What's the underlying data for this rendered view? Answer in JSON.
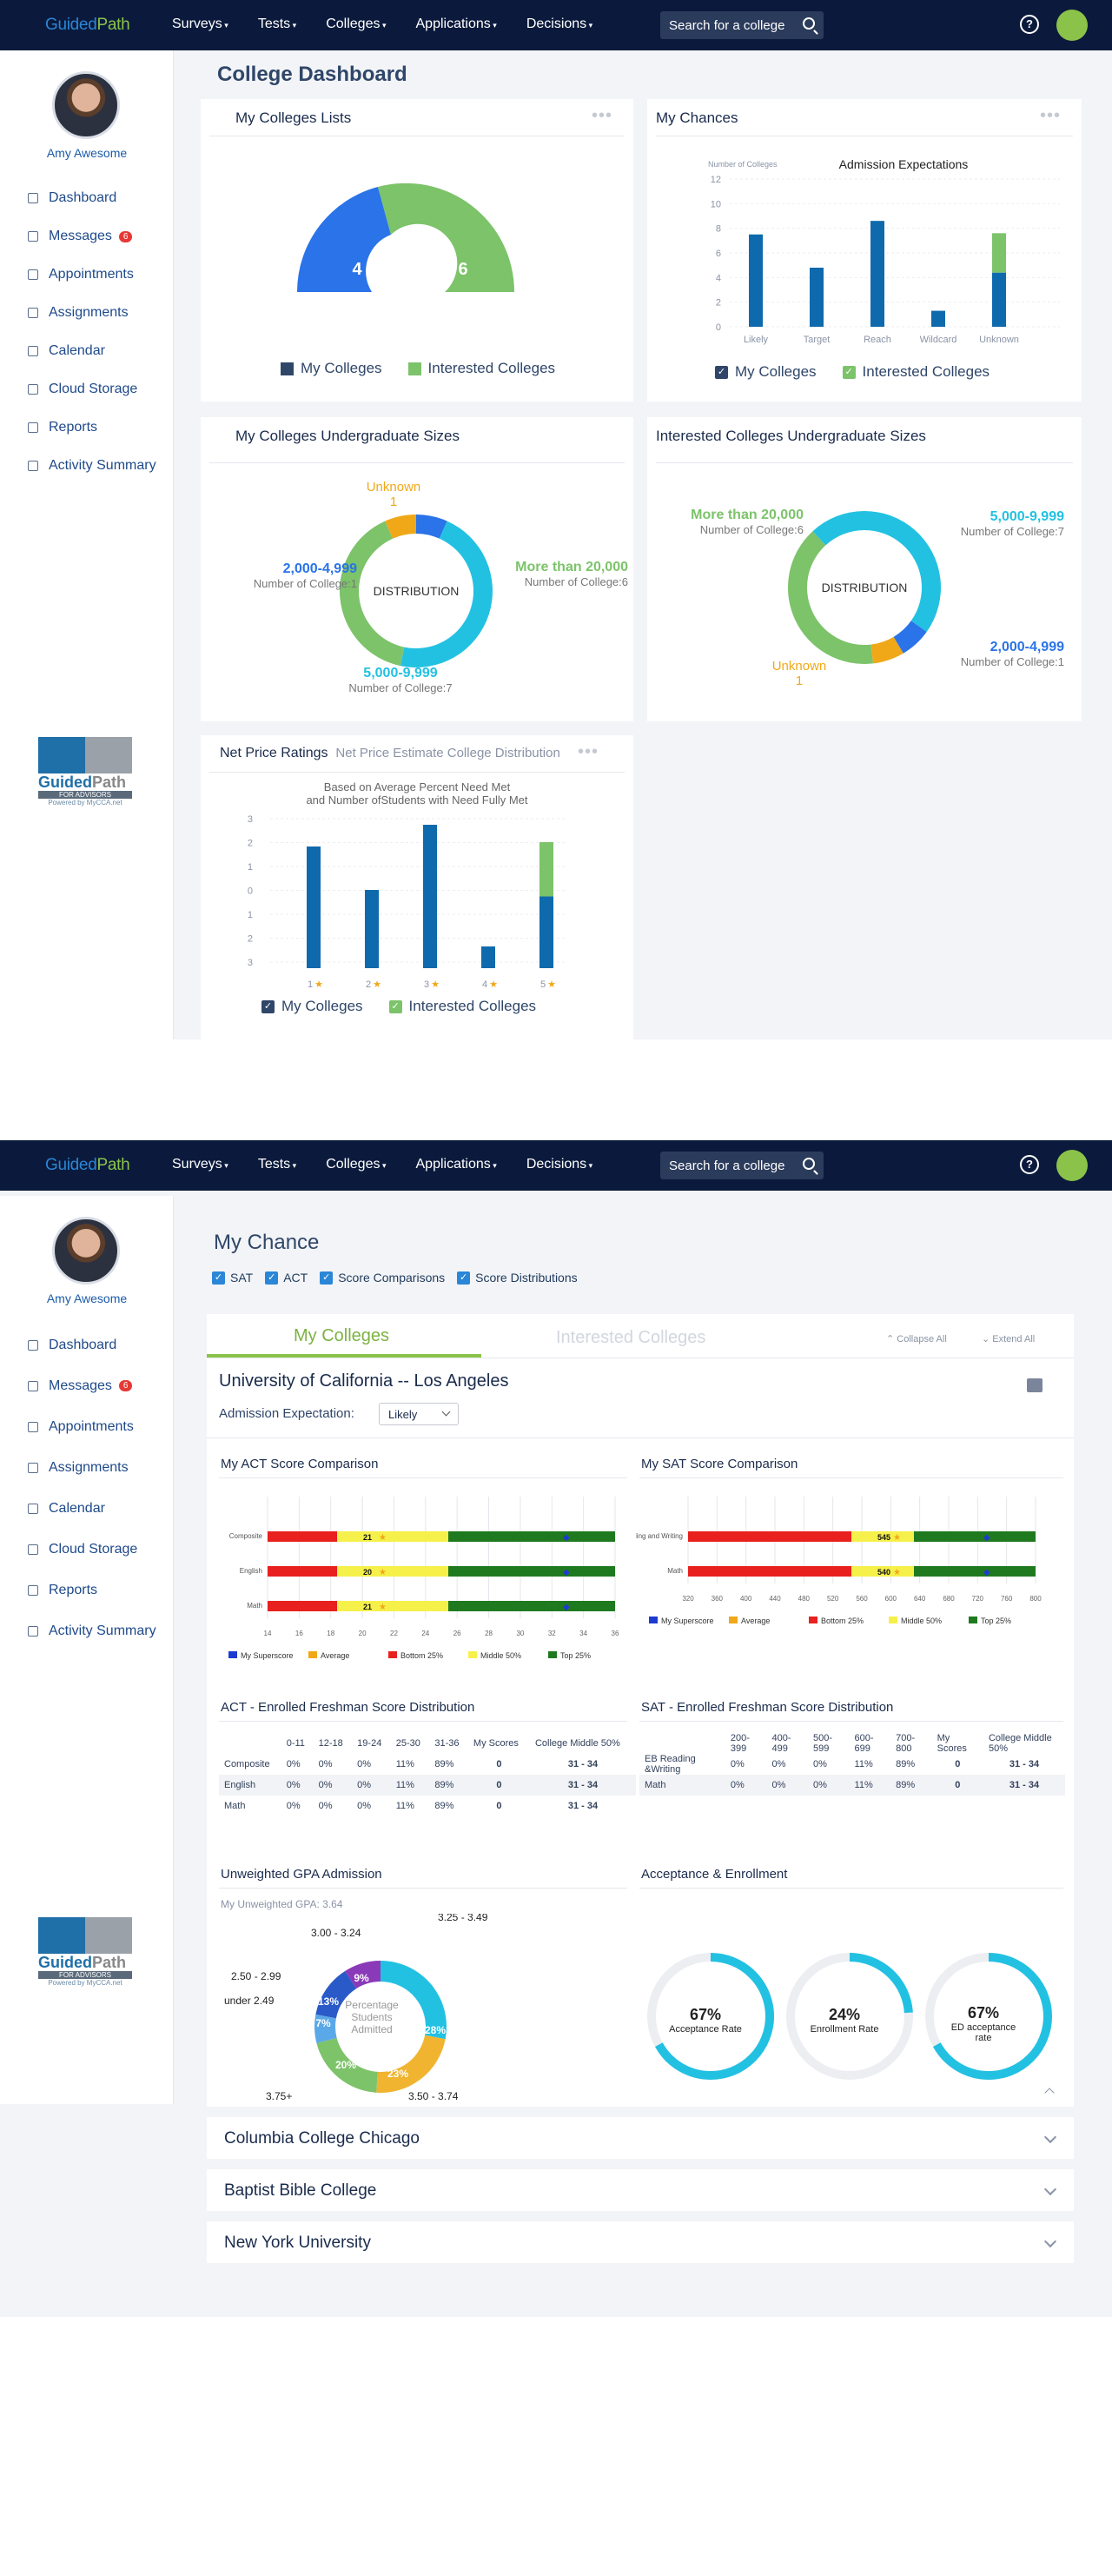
{
  "brand": {
    "logo_a": "Guided",
    "logo_b": "Path"
  },
  "nav": [
    "Surveys",
    "Tests",
    "Colleges",
    "Applications",
    "Decisions"
  ],
  "search_placeholder": "Search for a college",
  "help": "?",
  "user": {
    "name": "Amy Awesome"
  },
  "sidebar": {
    "items": [
      {
        "label": "Dashboard"
      },
      {
        "label": "Messages",
        "badge": "6"
      },
      {
        "label": "Appointments"
      },
      {
        "label": "Assignments"
      },
      {
        "label": "Calendar"
      },
      {
        "label": "Cloud Storage"
      },
      {
        "label": "Reports"
      },
      {
        "label": "Activity Summary"
      }
    ]
  },
  "footer_logo": {
    "word_a": "Guided",
    "word_b": "Path",
    "sub": "FOR ADVISORS",
    "powered": "Powered by MyCCA.net"
  },
  "dashboard": {
    "title": "College Dashboard",
    "lists": {
      "title": "My Colleges Lists",
      "my": "4",
      "interested": "6"
    },
    "chances": {
      "title": "My Chances",
      "chart_title": "Admission Expectations",
      "ylabel": "Number of Colleges"
    },
    "ug_my": {
      "title": "My Colleges Undergraduate Sizes",
      "center": "DISTRIBUTION",
      "segments": [
        {
          "label": "Unknown",
          "count": "1",
          "color": "#f0a818"
        },
        {
          "label": "2,000-4,999",
          "count": "1",
          "color": "#2a73e8"
        },
        {
          "label": "5,000-9,999",
          "count": "7",
          "color": "#22c1e2"
        },
        {
          "label": "More than 20,000",
          "count": "6",
          "color": "#7cc36a"
        }
      ],
      "count_prefix": "Number of College:"
    },
    "ug_int": {
      "title": "Interested Colleges Undergraduate Sizes",
      "center": "DISTRIBUTION",
      "segments": [
        {
          "label": "More than 20,000",
          "count": "6"
        },
        {
          "label": "5,000-9,999",
          "count": "7"
        },
        {
          "label": "2,000-4,999",
          "count": "1"
        },
        {
          "label": "Unknown",
          "count": "1"
        }
      ],
      "count_prefix": "Number of College:"
    },
    "net": {
      "title": "Net Price Ratings",
      "subtitle": "Net Price Estimate College Distribution",
      "chart_title_1": "Based on Average Percent Need Met",
      "chart_title_2": "and Number ofStudents with Need Fully Met"
    },
    "legend_my": "My Colleges",
    "legend_int": "Interested Colleges"
  },
  "chart_data": [
    {
      "type": "pie",
      "title": "",
      "values": [
        {
          "name": "My Colleges",
          "value": 4
        },
        {
          "name": "Interested Colleges",
          "value": 6
        }
      ]
    },
    {
      "type": "bar",
      "title": "Admission Expectations",
      "ylabel": "Number of Colleges",
      "categories": [
        "Likely",
        "Target",
        "Reach",
        "Wildcard",
        "Unknown"
      ],
      "ylim": [
        0,
        12
      ],
      "yticks": [
        0,
        2,
        4,
        6,
        8,
        10,
        12
      ],
      "series": [
        {
          "name": "My Colleges",
          "values": [
            7.5,
            4.8,
            8.6,
            1.3,
            4.4
          ]
        },
        {
          "name": "Interested Colleges",
          "values": [
            0,
            0,
            0,
            0,
            3.2
          ]
        }
      ]
    },
    {
      "type": "pie",
      "title": "",
      "values": [
        {
          "name": "Unknown",
          "value": 1
        },
        {
          "name": "2,000-4,999",
          "value": 1
        },
        {
          "name": "5,000-9,999",
          "value": 7
        },
        {
          "name": "More than 20,000",
          "value": 6
        }
      ]
    },
    {
      "type": "pie",
      "title": "",
      "values": [
        {
          "name": "More than 20,000",
          "value": 6
        },
        {
          "name": "5,000-9,999",
          "value": 7
        },
        {
          "name": "2,000-4,999",
          "value": 1
        },
        {
          "name": "Unknown",
          "value": 1
        }
      ]
    },
    {
      "type": "bar",
      "title": "",
      "categories": [
        "1",
        "2",
        "3",
        "4",
        "5"
      ],
      "yticks": [
        "3",
        "2",
        "1",
        "0",
        "1",
        "2",
        "3"
      ],
      "series": [
        {
          "name": "My Colleges",
          "values": [
            5.6,
            3.6,
            6.6,
            1.0,
            3.3
          ]
        },
        {
          "name": "Interested Colleges",
          "values": [
            0,
            0,
            0,
            0,
            2.5
          ]
        }
      ]
    }
  ],
  "mychance": {
    "title": "My Chance",
    "checks": [
      "SAT",
      "ACT",
      "Score Comparisons",
      "Score Distributions"
    ],
    "tab_my": "My Colleges",
    "tab_int": "Interested Colleges",
    "collapse": "Collapse All",
    "extend": "Extend All",
    "college": "University of California -- Los Angeles",
    "adm_label": "Admission Expectation:",
    "adm_value": "Likely",
    "act_title": "My ACT Score Comparison",
    "sat_title": "My SAT Score Comparison",
    "act_rows": [
      "Composite",
      "English",
      "Math"
    ],
    "act_scores": [
      "21",
      "20",
      "21"
    ],
    "act_ticks": [
      "14",
      "16",
      "18",
      "20",
      "22",
      "24",
      "26",
      "28",
      "30",
      "32",
      "34",
      "36"
    ],
    "sat_rows": [
      "EB Reading and Writing",
      "Math"
    ],
    "sat_scores": [
      "545",
      "540"
    ],
    "sat_ticks": [
      "320",
      "360",
      "400",
      "440",
      "480",
      "520",
      "560",
      "600",
      "640",
      "680",
      "720",
      "760",
      "800"
    ],
    "score_legend": [
      "My Superscore",
      "Average",
      "Bottom 25%",
      "Middle 50%",
      "Top 25%"
    ],
    "act_dist_title": "ACT - Enrolled Freshman Score Distribution",
    "act_dist": {
      "headers": [
        "",
        "0-11",
        "12-18",
        "19-24",
        "25-30",
        "31-36",
        "My Scores",
        "College Middle 50%"
      ],
      "rows": [
        [
          "Composite",
          "0%",
          "0%",
          "0%",
          "11%",
          "89%",
          "0",
          "31 - 34"
        ],
        [
          "English",
          "0%",
          "0%",
          "0%",
          "11%",
          "89%",
          "0",
          "31 - 34"
        ],
        [
          "Math",
          "0%",
          "0%",
          "0%",
          "11%",
          "89%",
          "0",
          "31 - 34"
        ]
      ]
    },
    "sat_dist_title": "SAT - Enrolled Freshman Score Distribution",
    "sat_dist": {
      "headers": [
        "",
        "200-399",
        "400-499",
        "500-599",
        "600-699",
        "700-800",
        "My Scores",
        "College Middle 50%"
      ],
      "rows": [
        [
          "EB Reading &Writing",
          "0%",
          "0%",
          "0%",
          "11%",
          "89%",
          "0",
          "31 - 34"
        ],
        [
          "Math",
          "0%",
          "0%",
          "0%",
          "11%",
          "89%",
          "0",
          "31 - 34"
        ]
      ]
    },
    "gpa_title": "Unweighted GPA Admission",
    "gpa_sub": "My Unweighted GPA: 3.64",
    "gpa_center": "Percentage Students Admitted",
    "gpa_segments": [
      {
        "label": "3.25 - 3.49",
        "pct": "28%"
      },
      {
        "label": "3.50 - 3.74",
        "pct": "23%"
      },
      {
        "label": "3.75+",
        "pct": "20%"
      },
      {
        "label": "under 2.49",
        "pct": "7%"
      },
      {
        "label": "2.50 - 2.99",
        "pct": "13%"
      },
      {
        "label": "3.00 - 3.24",
        "pct": "9%"
      }
    ],
    "acc_title": "Acceptance &  Enrollment",
    "rings": [
      {
        "value": "67%",
        "label": "Acceptance Rate",
        "pct": 0.67
      },
      {
        "value": "24%",
        "label": "Enrollment Rate",
        "pct": 0.24
      },
      {
        "value": "67%",
        "label": "ED acceptance rate",
        "pct": 0.67
      }
    ],
    "others": [
      "Columbia College Chicago",
      "Baptist Bible College",
      "New York University"
    ]
  }
}
